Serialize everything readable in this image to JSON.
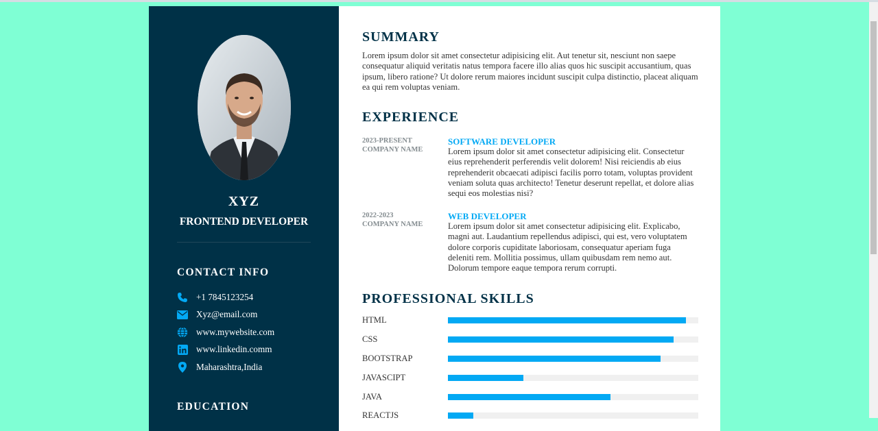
{
  "profile": {
    "name": "XYZ",
    "role": "FRONTEND DEVELOPER"
  },
  "contact": {
    "title": "CONTACT INFO",
    "items": [
      {
        "icon": "phone-icon",
        "text": "+1 7845123254"
      },
      {
        "icon": "mail-icon",
        "text": "Xyz@email.com"
      },
      {
        "icon": "globe-icon",
        "text": "www.mywebsite.com"
      },
      {
        "icon": "linkedin-icon",
        "text": "www.linkedin.comm"
      },
      {
        "icon": "location-icon",
        "text": "Maharashtra,India"
      }
    ]
  },
  "education": {
    "title": "EDUCATION"
  },
  "summary": {
    "title": "SUMMARY",
    "text": "Lorem ipsum dolor sit amet consectetur adipisicing elit. Aut tenetur sit, nesciunt non saepe consequatur aliquid veritatis natus tempora facere illo alias quos hic suscipit accusantium, quas ipsum, libero ratione? Ut dolore rerum maiores incidunt suscipit culpa distinctio, placeat aliquam ea qui rem voluptas veniam."
  },
  "experience": {
    "title": "EXPERIENCE",
    "items": [
      {
        "period": "2023-PRESENT",
        "company": "COMPANY NAME",
        "role": "SOFTWARE DEVELOPER",
        "text": "Lorem ipsum dolor sit amet consectetur adipisicing elit. Consectetur eius reprehenderit perferendis velit dolorem! Nisi reiciendis ab eius reprehenderit obcaecati adipisci facilis porro totam, voluptas provident veniam soluta quas architecto! Tenetur deserunt repellat, et dolore alias sequi eos molestias nisi?"
      },
      {
        "period": "2022-2023",
        "company": "COMPANY NAME",
        "role": "WEB DEVELOPER",
        "text": "Lorem ipsum dolor sit amet consectetur adipisicing elit. Explicabo, magni aut. Laudantium repellendus adipisci, qui est, vero voluptatem dolore corporis cupiditate laboriosam, consequatur aperiam fuga deleniti rem. Mollitia possimus, ullam quibusdam rem nemo aut. Dolorum tempore eaque tempora rerum corrupti."
      }
    ]
  },
  "skills": {
    "title": "PROFESSIONAL SKILLS",
    "items": [
      {
        "name": "HTML",
        "percent": 95
      },
      {
        "name": "CSS",
        "percent": 90
      },
      {
        "name": "BOOTSTRAP",
        "percent": 85
      },
      {
        "name": "JAVASCIPT",
        "percent": 30
      },
      {
        "name": "JAVA",
        "percent": 65
      },
      {
        "name": "REACTJS",
        "percent": 10
      }
    ]
  },
  "colors": {
    "page_bg": "#7fffd4",
    "sidebar_bg": "#003147",
    "accent": "#03a9f4",
    "heading": "#003147"
  }
}
